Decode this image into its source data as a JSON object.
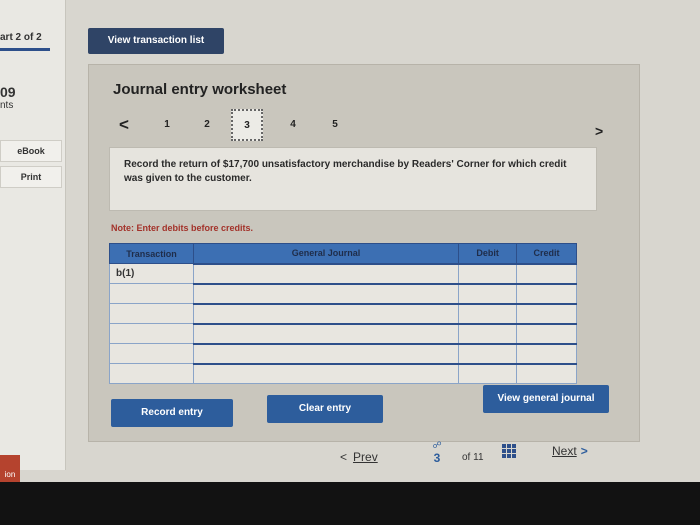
{
  "sidebar": {
    "part": "art 2 of 2",
    "points_num": "09",
    "points_label": "nts",
    "ebook": "eBook",
    "print": "Print",
    "bottom": "ion"
  },
  "topbar": {
    "view_transactions": "View transaction list"
  },
  "worksheet": {
    "title": "Journal entry worksheet",
    "prev_arrow": "<",
    "next_arrow": ">",
    "steps": [
      "1",
      "2",
      "3",
      "4",
      "5"
    ],
    "active_step": "3",
    "question": "Record the return of $17,700 unsatisfactory merchandise by Readers' Corner for which credit was given to the customer.",
    "note": "Note: Enter debits before credits.",
    "table": {
      "headers": [
        "Transaction",
        "General Journal",
        "Debit",
        "Credit"
      ],
      "rows": [
        [
          "b(1)",
          "",
          "",
          ""
        ],
        [
          "",
          "",
          "",
          ""
        ],
        [
          "",
          "",
          "",
          ""
        ],
        [
          "",
          "",
          "",
          ""
        ],
        [
          "",
          "",
          "",
          ""
        ],
        [
          "",
          "",
          "",
          ""
        ]
      ]
    },
    "buttons": {
      "record": "Record entry",
      "clear": "Clear entry",
      "view_journal": "View general journal"
    }
  },
  "pager": {
    "prev": "Prev",
    "page_link": "☍",
    "current": "3",
    "of": "of 11",
    "next": "Next"
  },
  "colors": {
    "header_blue": "#3c6fb3",
    "button_blue": "#2d5d9c",
    "topbar_navy": "#2f4466",
    "note_red": "#a3322a"
  }
}
